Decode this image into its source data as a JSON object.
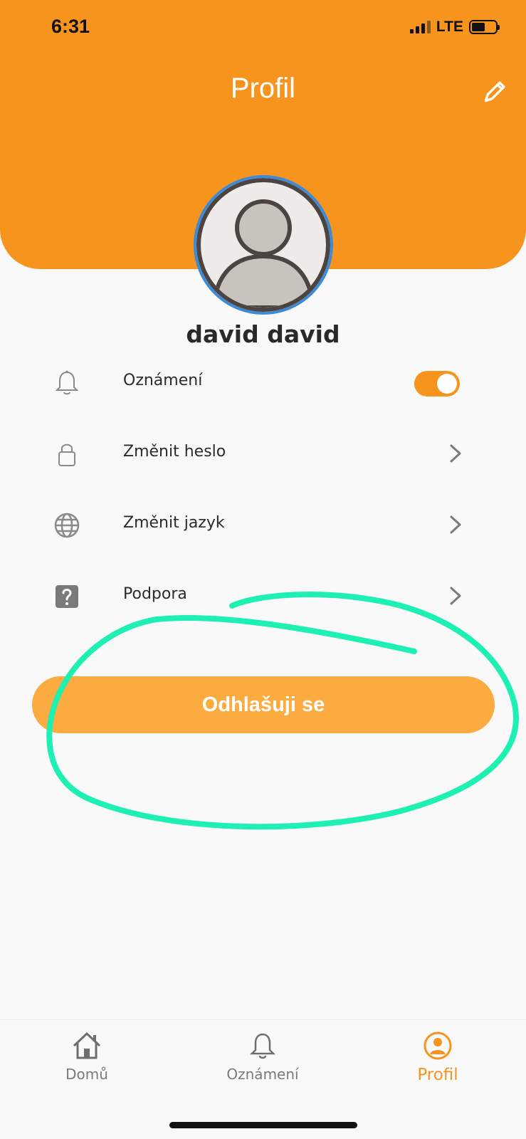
{
  "status_bar": {
    "time": "6:31",
    "network": "LTE"
  },
  "header": {
    "title": "Profil",
    "edit_icon": "pencil-icon"
  },
  "profile": {
    "name": "david david",
    "avatar_icon": "user-avatar"
  },
  "menu": {
    "items": [
      {
        "label": "Oznámení",
        "icon": "bell-icon",
        "control": "toggle",
        "toggle_on": true
      },
      {
        "label": "Změnit heslo",
        "icon": "lock-icon",
        "control": "chevron"
      },
      {
        "label": "Změnit jazyk",
        "icon": "globe-icon",
        "control": "chevron"
      },
      {
        "label": "Podpora",
        "icon": "help-icon",
        "control": "chevron"
      }
    ]
  },
  "logout": {
    "label": "Odhlašuji se"
  },
  "tabbar": {
    "tabs": [
      {
        "label": "Domů",
        "icon": "home-icon",
        "active": false
      },
      {
        "label": "Oznámení",
        "icon": "bell-icon",
        "active": false
      },
      {
        "label": "Profil",
        "icon": "profile-icon",
        "active": true
      }
    ]
  },
  "colors": {
    "accent": "#f7941e",
    "button": "#fbab40",
    "annotation": "#1ef0b4",
    "background": "#f9f9f9"
  }
}
